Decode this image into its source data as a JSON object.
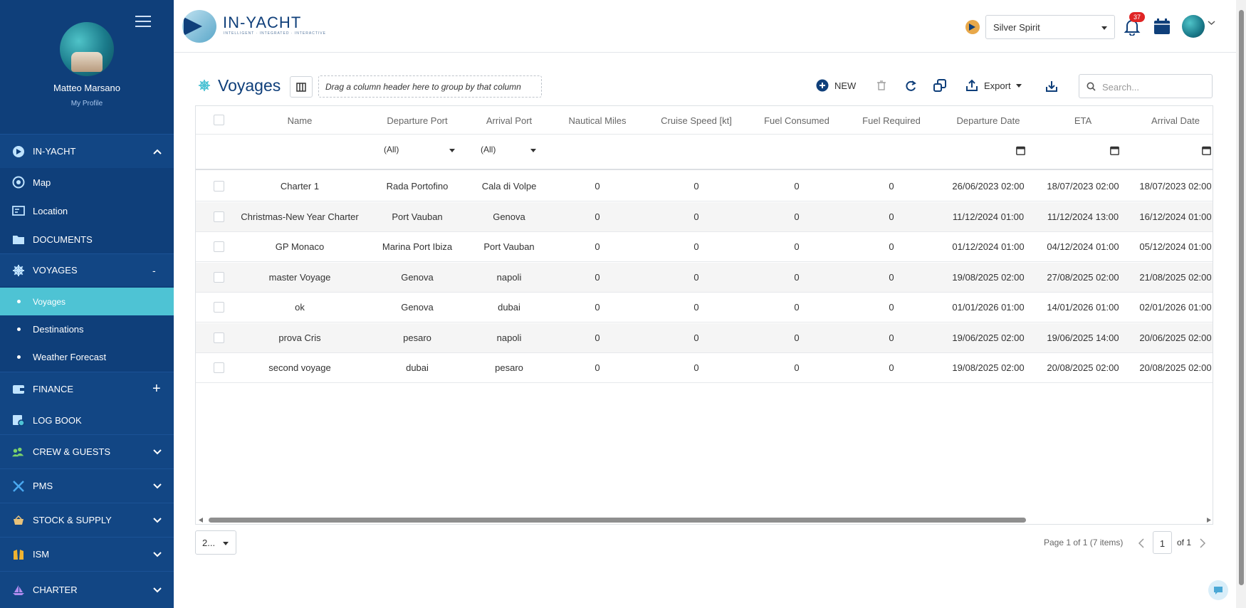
{
  "sidebar": {
    "user_name": "Matteo Marsano",
    "profile_link": "My Profile",
    "items": [
      {
        "label": "IN-YACHT",
        "chevron": "^"
      },
      {
        "label": "Map"
      },
      {
        "label": "Location"
      },
      {
        "label": "DOCUMENTS"
      },
      {
        "label": "VOYAGES",
        "chevron": "-"
      },
      {
        "label": "Voyages"
      },
      {
        "label": "Destinations"
      },
      {
        "label": "Weather Forecast"
      },
      {
        "label": "FINANCE",
        "chevron": "+"
      },
      {
        "label": "LOG BOOK"
      },
      {
        "label": "CREW & GUESTS",
        "chevron": "∨"
      },
      {
        "label": "PMS",
        "chevron": "∨"
      },
      {
        "label": "STOCK & SUPPLY",
        "chevron": "∨"
      },
      {
        "label": "ISM",
        "chevron": "∨"
      },
      {
        "label": "CHARTER",
        "chevron": "∨"
      }
    ]
  },
  "header": {
    "logo_text": "IN-YACHT",
    "logo_tagline": "INTELLIGENT · INTEGRATED · INTERACTIVE",
    "vessel": "Silver Spirit",
    "notifications": "37"
  },
  "toolbar": {
    "title": "Voyages",
    "group_panel": "Drag a column header here to group by that column",
    "new_label": "NEW",
    "export_label": "Export",
    "search_placeholder": "Search..."
  },
  "grid": {
    "columns": [
      "Name",
      "Departure Port",
      "Arrival Port",
      "Nautical Miles",
      "Cruise Speed [kt]",
      "Fuel Consumed",
      "Fuel Required",
      "Departure Date",
      "ETA",
      "Arrival Date"
    ],
    "filters": {
      "departure_port": "(All)",
      "arrival_port": "(All)"
    },
    "rows": [
      [
        "Charter 1",
        "Rada Portofino",
        "Cala di Volpe",
        "0",
        "0",
        "0",
        "0",
        "26/06/2023 02:00",
        "18/07/2023 02:00",
        "18/07/2023 02:00"
      ],
      [
        "Christmas-New Year Charter",
        "Port Vauban",
        "Genova",
        "0",
        "0",
        "0",
        "0",
        "11/12/2024 01:00",
        "11/12/2024 13:00",
        "16/12/2024 01:00"
      ],
      [
        "GP Monaco",
        "Marina Port Ibiza",
        "Port Vauban",
        "0",
        "0",
        "0",
        "0",
        "01/12/2024 01:00",
        "04/12/2024 01:00",
        "05/12/2024 01:00"
      ],
      [
        "master Voyage",
        "Genova",
        "napoli",
        "0",
        "0",
        "0",
        "0",
        "19/08/2025 02:00",
        "27/08/2025 02:00",
        "21/08/2025 02:00"
      ],
      [
        "ok",
        "Genova",
        "dubai",
        "0",
        "0",
        "0",
        "0",
        "01/01/2026 01:00",
        "14/01/2026 01:00",
        "02/01/2026 01:00"
      ],
      [
        "prova Cris",
        "pesaro",
        "napoli",
        "0",
        "0",
        "0",
        "0",
        "19/06/2025 02:00",
        "19/06/2025 14:00",
        "20/06/2025 02:00"
      ],
      [
        "second voyage",
        "dubai",
        "pesaro",
        "0",
        "0",
        "0",
        "0",
        "19/08/2025 02:00",
        "20/08/2025 02:00",
        "20/08/2025 02:00"
      ]
    ]
  },
  "pager": {
    "page_size": "2...",
    "info": "Page 1 of 1 (7 items)",
    "current": "1",
    "of": "of 1"
  }
}
